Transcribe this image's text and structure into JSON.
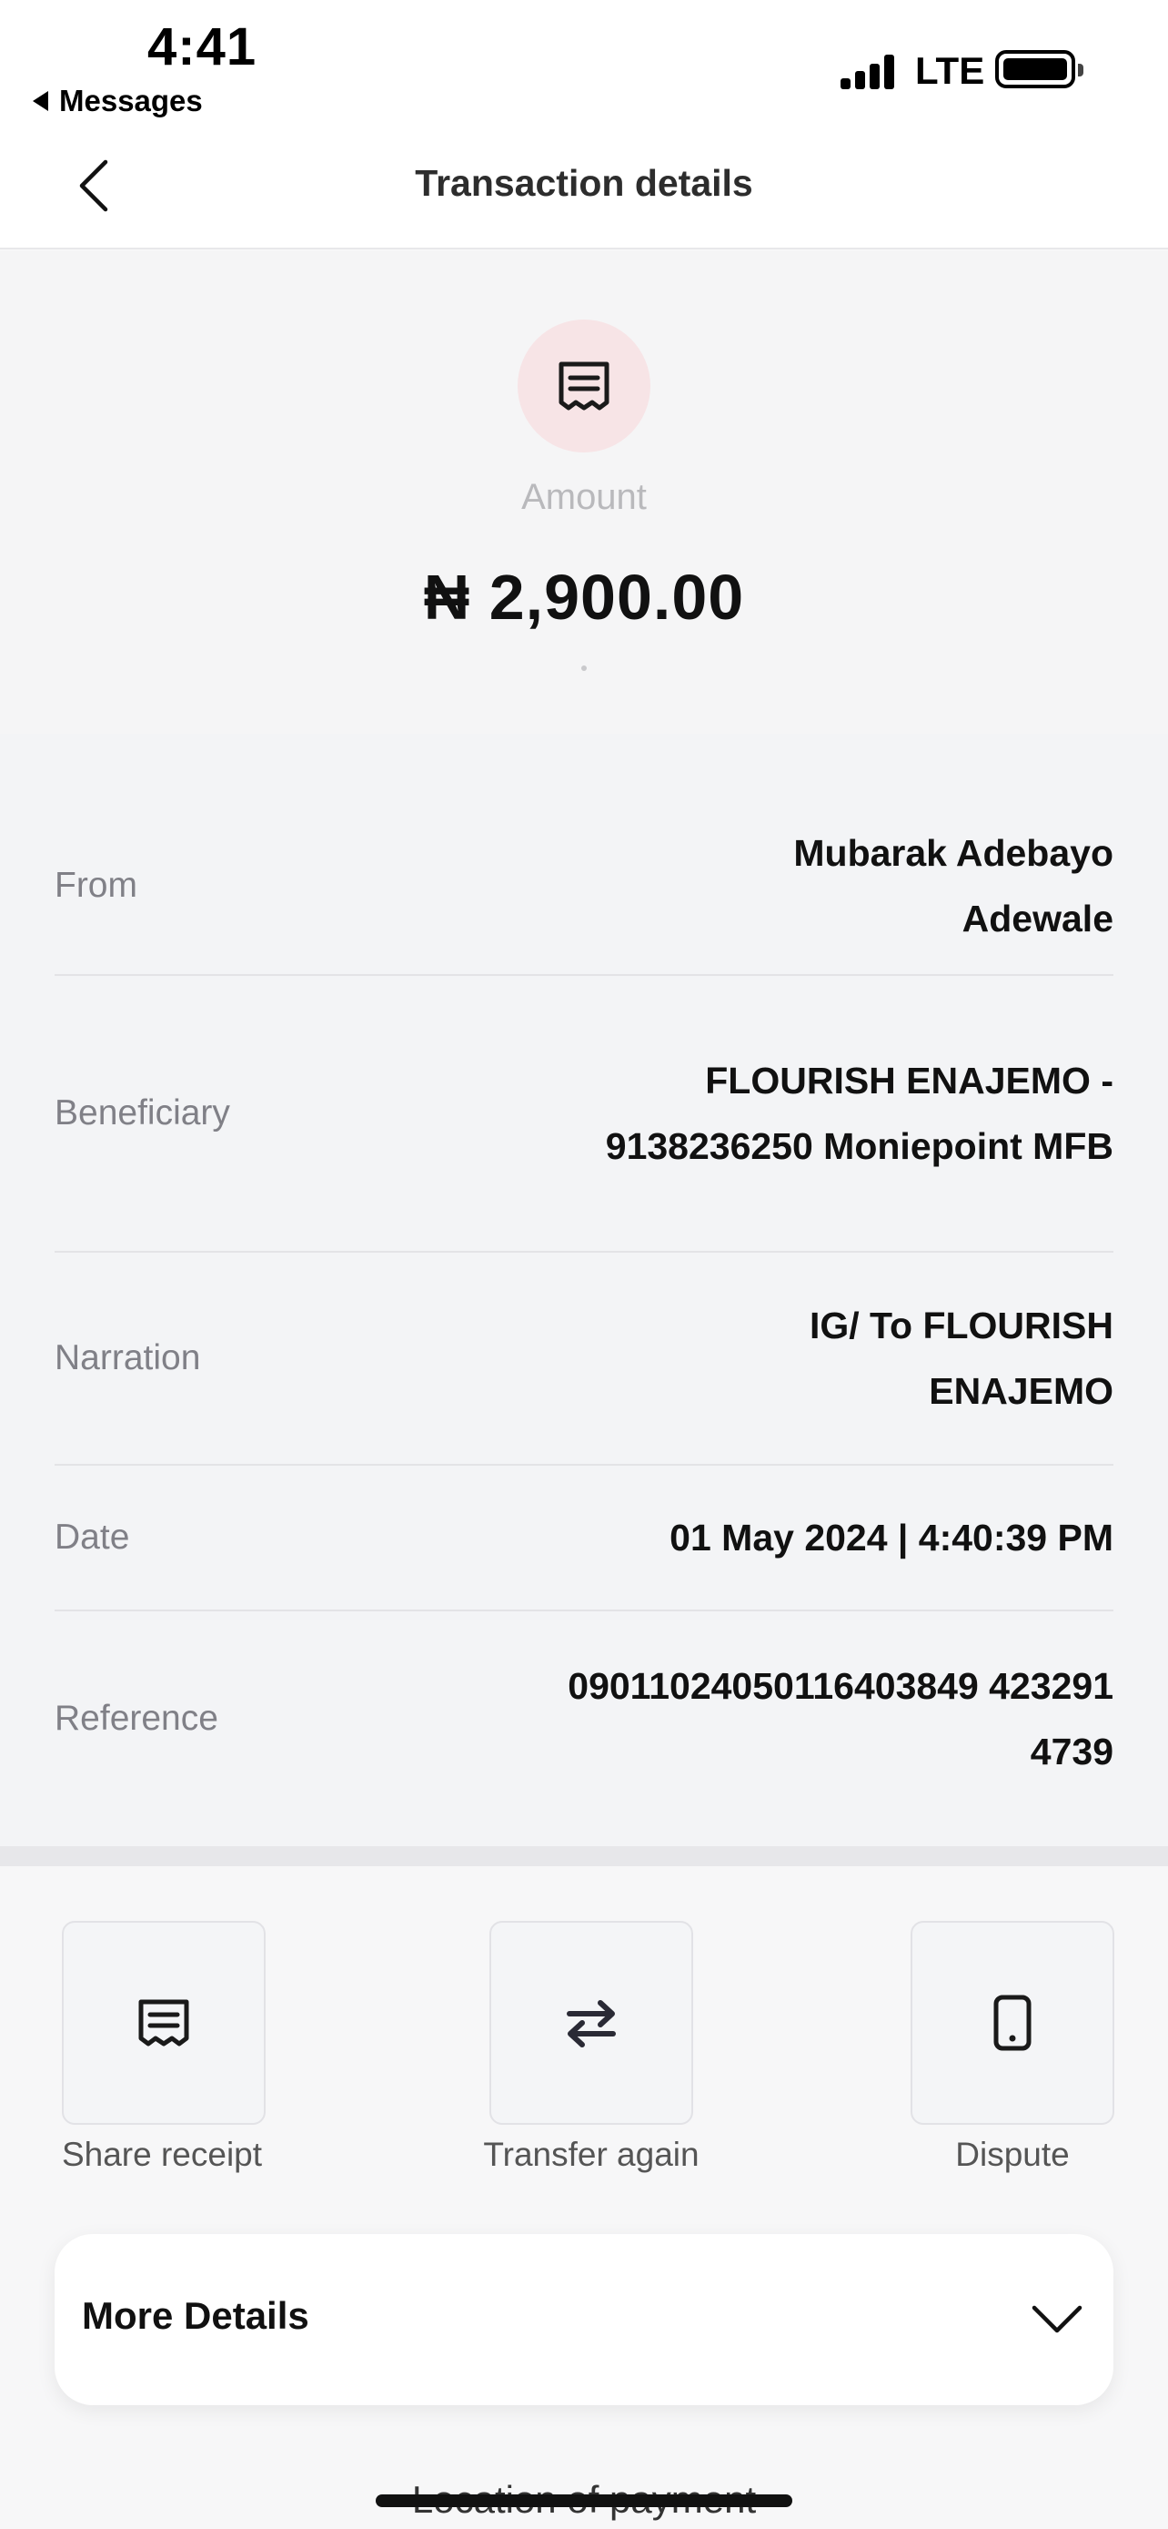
{
  "status_bar": {
    "time": "4:41",
    "back_app": "Messages",
    "network": "LTE"
  },
  "header": {
    "title": "Transaction details",
    "back_icon": "chevron-left-icon"
  },
  "amount": {
    "icon": "receipt-icon",
    "label": "Amount",
    "value": "₦ 2,900.00"
  },
  "details": {
    "rows": [
      {
        "label": "From",
        "value": "Mubarak Adebayo Adewale"
      },
      {
        "label": "Beneficiary",
        "value": "FLOURISH ENAJEMO - 9138236250 Moniepoint MFB"
      },
      {
        "label": "Narration",
        "value": "IG/ To FLOURISH ENAJEMO"
      },
      {
        "label": "Date",
        "value": "01 May 2024 | 4:40:39 PM"
      },
      {
        "label": "Reference",
        "value": "09011024050116403849 4232914739"
      }
    ]
  },
  "actions": [
    {
      "label": "Share receipt",
      "icon": "receipt-icon"
    },
    {
      "label": "Transfer again",
      "icon": "transfer-arrows-icon"
    },
    {
      "label": "Dispute",
      "icon": "phone-icon"
    }
  ],
  "more_details": {
    "title": "More Details",
    "icon": "chevron-down-icon"
  },
  "footer": {
    "location_text": "Location of payment"
  },
  "colors": {
    "accent_circle": "#f7e4e6",
    "text_primary": "#111111",
    "text_muted": "#808087"
  }
}
